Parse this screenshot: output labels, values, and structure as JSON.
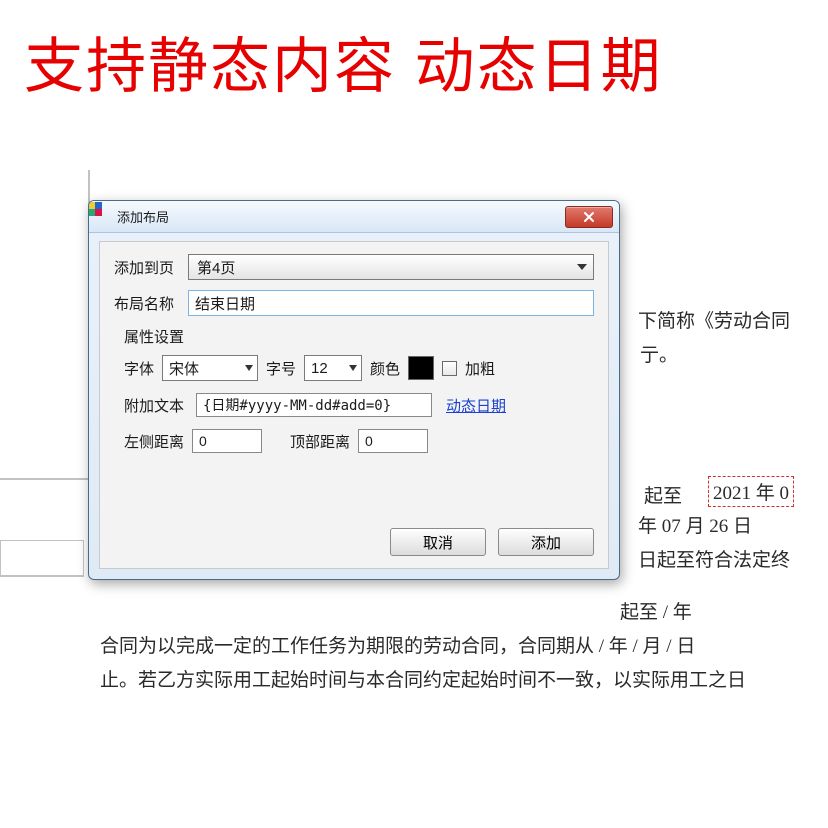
{
  "headline": "支持静态内容 动态日期",
  "dialog": {
    "title": "添加布局",
    "labels": {
      "add_to_page": "添加到页",
      "layout_name": "布局名称",
      "prop_group": "属性设置",
      "font": "字体",
      "font_size": "字号",
      "color": "颜色",
      "bold": "加粗",
      "extra_text": "附加文本",
      "dynamic_date": "动态日期",
      "left_distance": "左侧距离",
      "top_distance": "顶部距离"
    },
    "values": {
      "page": "第4页",
      "layout_name_value": "结束日期",
      "font_value": "宋体",
      "font_size_value": "12",
      "color_hex": "#000000",
      "bold_checked": false,
      "extra_text_value": "{日期#yyyy-MM-dd#add=0}",
      "left_distance_value": "0",
      "top_distance_value": "0"
    },
    "buttons": {
      "cancel": "取消",
      "add": "添加"
    }
  },
  "background": {
    "snippets": {
      "s1": "下简称《劳动合同",
      "s2": "亍。",
      "s3": "起至",
      "s4": "2021 年 0",
      "s5": " 年 07 月 26 日",
      "s6": "日起至符合法定终",
      "s7": "起至   /  年",
      "s8": "合同为以完成一定的工作任务为期限的劳动合同，合同期从  / 年  / 月 / 日",
      "s9": "止。若乙方实际用工起始时间与本合同约定起始时间不一致，以实际用工之日"
    }
  }
}
